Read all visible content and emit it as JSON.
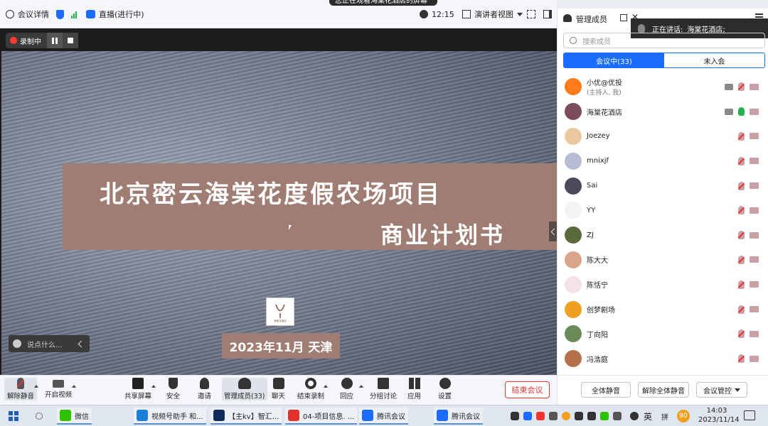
{
  "top_bar": {
    "meeting_details": "会议详情",
    "live_status": "直播(进行中)",
    "time": "12:15",
    "view_mode": "演讲者视图",
    "share_banner": "您正在观看海棠花酒店的屏幕"
  },
  "recording": {
    "label": "录制中"
  },
  "slide": {
    "title_line1": "北京密云海棠花度假农场项目",
    "title_line2": "商业计划书",
    "logo_text": "海棠花酒店",
    "date_text": "2023年11月 天津"
  },
  "chat_input": {
    "placeholder": "说点什么..."
  },
  "bottom_toolbar": {
    "unmute": "解除静音",
    "start_video": "开启视频",
    "share_screen": "共享屏幕",
    "security": "安全",
    "invite": "邀请",
    "manage_members": "管理成员(33)",
    "chat": "聊天",
    "end_recording": "结束录制",
    "reactions": "回应",
    "breakout": "分组讨论",
    "apps": "应用",
    "settings": "设置",
    "end_meeting": "结束会议"
  },
  "panel": {
    "title": "管理成员",
    "speaking_label": "正在讲话:",
    "speaking_name": "海棠花酒店;",
    "search_placeholder": "搜索成员",
    "tab_in_meeting": "会议中(33)",
    "tab_not_joined": "未入会",
    "members": [
      {
        "name": "小优@优投",
        "sub": "(主持人, 我)",
        "avatar_color": "#ff7a1a",
        "mic": "off",
        "extra": true
      },
      {
        "name": "海棠花酒店",
        "sub": "",
        "avatar_color": "#7b4b5e",
        "mic": "on",
        "extra": true
      },
      {
        "name": "Joezey",
        "sub": "",
        "avatar_color": "#e8c9a0",
        "mic": "off",
        "extra": false
      },
      {
        "name": "mnixjf",
        "sub": "",
        "avatar_color": "#b6bcd2",
        "mic": "off",
        "extra": false
      },
      {
        "name": "Sai",
        "sub": "",
        "avatar_color": "#4a4a5a",
        "mic": "off",
        "extra": false
      },
      {
        "name": "YY",
        "sub": "",
        "avatar_color": "#f3f3f3",
        "mic": "off",
        "extra": false
      },
      {
        "name": "ZJ",
        "sub": "",
        "avatar_color": "#5a6a3a",
        "mic": "off",
        "extra": false
      },
      {
        "name": "陈大大",
        "sub": "",
        "avatar_color": "#d9a58a",
        "mic": "off",
        "extra": false
      },
      {
        "name": "陈恬宁",
        "sub": "",
        "avatar_color": "#f4e3e6",
        "mic": "off",
        "extra": false
      },
      {
        "name": "创梦剧场",
        "sub": "",
        "avatar_color": "#f0a020",
        "mic": "off",
        "extra": false
      },
      {
        "name": "丁向阳",
        "sub": "",
        "avatar_color": "#6b8a5a",
        "mic": "off",
        "extra": false
      },
      {
        "name": "冯浩庭",
        "sub": "",
        "avatar_color": "#b5714a",
        "mic": "off",
        "extra": false
      }
    ],
    "mute_all": "全体静音",
    "unmute_all": "解除全体静音",
    "meeting_control": "会议管控"
  },
  "taskbar": {
    "apps": [
      {
        "label": "微信",
        "color": "#2dc100"
      },
      {
        "label": "视频号助手 和...",
        "color": "#1a7fd6"
      },
      {
        "label": "【主kv】智汇...",
        "color": "#0e2b5c"
      },
      {
        "label": "04-项目信息. ...",
        "color": "#e3322b"
      },
      {
        "label": "腾讯会议",
        "color": "#1a6cff"
      },
      {
        "label": "腾讯会议",
        "color": "#1a6cff"
      }
    ],
    "ime_lang": "英",
    "ime_mode": "拼",
    "tray_badge": "90",
    "time": "14:03",
    "date": "2023/11/14"
  }
}
